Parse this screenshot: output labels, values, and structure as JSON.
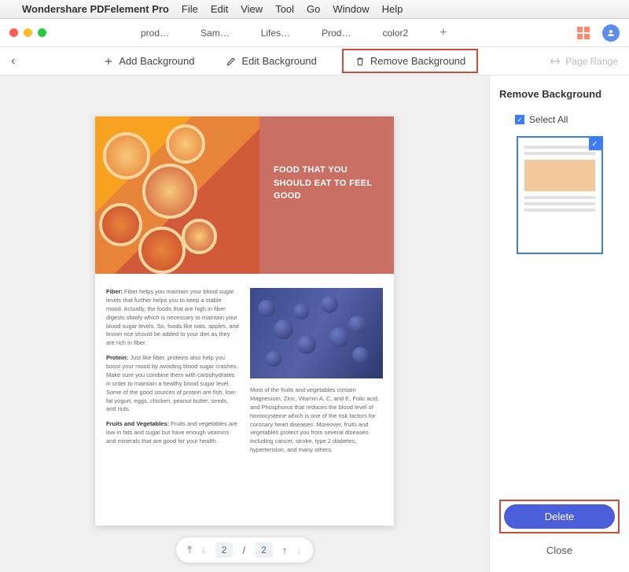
{
  "menubar": {
    "app": "Wondershare PDFelement Pro",
    "items": [
      "File",
      "Edit",
      "View",
      "Tool",
      "Go",
      "Window",
      "Help"
    ]
  },
  "window": {
    "tabs": [
      "prod…",
      "Sam…",
      "Lifes…",
      "Prod…",
      "color2"
    ]
  },
  "toolbar": {
    "add_bg": "Add Background",
    "edit_bg": "Edit Background",
    "remove_bg": "Remove Background",
    "page_range": "Page Range"
  },
  "document": {
    "hero_title": "FOOD THAT YOU SHOULD EAT TO FEEL GOOD",
    "col1": {
      "p1_label": "Fiber:",
      "p1": " Fiber helps you maintain your blood sugar levels that further helps you to keep a stable mood. Actually, the foods that are high in fiber digests slowly which is necessary to maintain your blood sugar levels. So, foods like oats, apples, and brown rice should be added to your diet as they are rich in fiber.",
      "p2_label": "Protein:",
      "p2": " Just like fiber, proteins also help you boost your mood by avoiding blood sugar crashes. Make sure you combine them with carbohydrates in order to maintain a healthy blood sugar level. Some of the good sources of protein are fish, low-fat yogurt, eggs, chicken, peanut butter, seeds, and nuts.",
      "p3_label": "Fruits and Vegetables:",
      "p3": " Fruits and vegetables are low in fats and sugar but have enough vitamins and minerals that are good for your health."
    },
    "col2": {
      "p1": "Most of the fruits and vegetables contain Magnesium, Zinc, Vitamin A, C, and E, Folic acid, and Phosphorus that reduces the blood level of homocysteine which is one of the risk factors for coronary heart diseases. Moreover, fruits and vegetables protect you from several diseases including cancer, stroke, type 2 diabetes, hypertension, and many others."
    }
  },
  "pager": {
    "current": "2",
    "sep": "/",
    "total": "2"
  },
  "panel": {
    "title": "Remove Background",
    "select_all": "Select All",
    "delete": "Delete",
    "close": "Close"
  }
}
